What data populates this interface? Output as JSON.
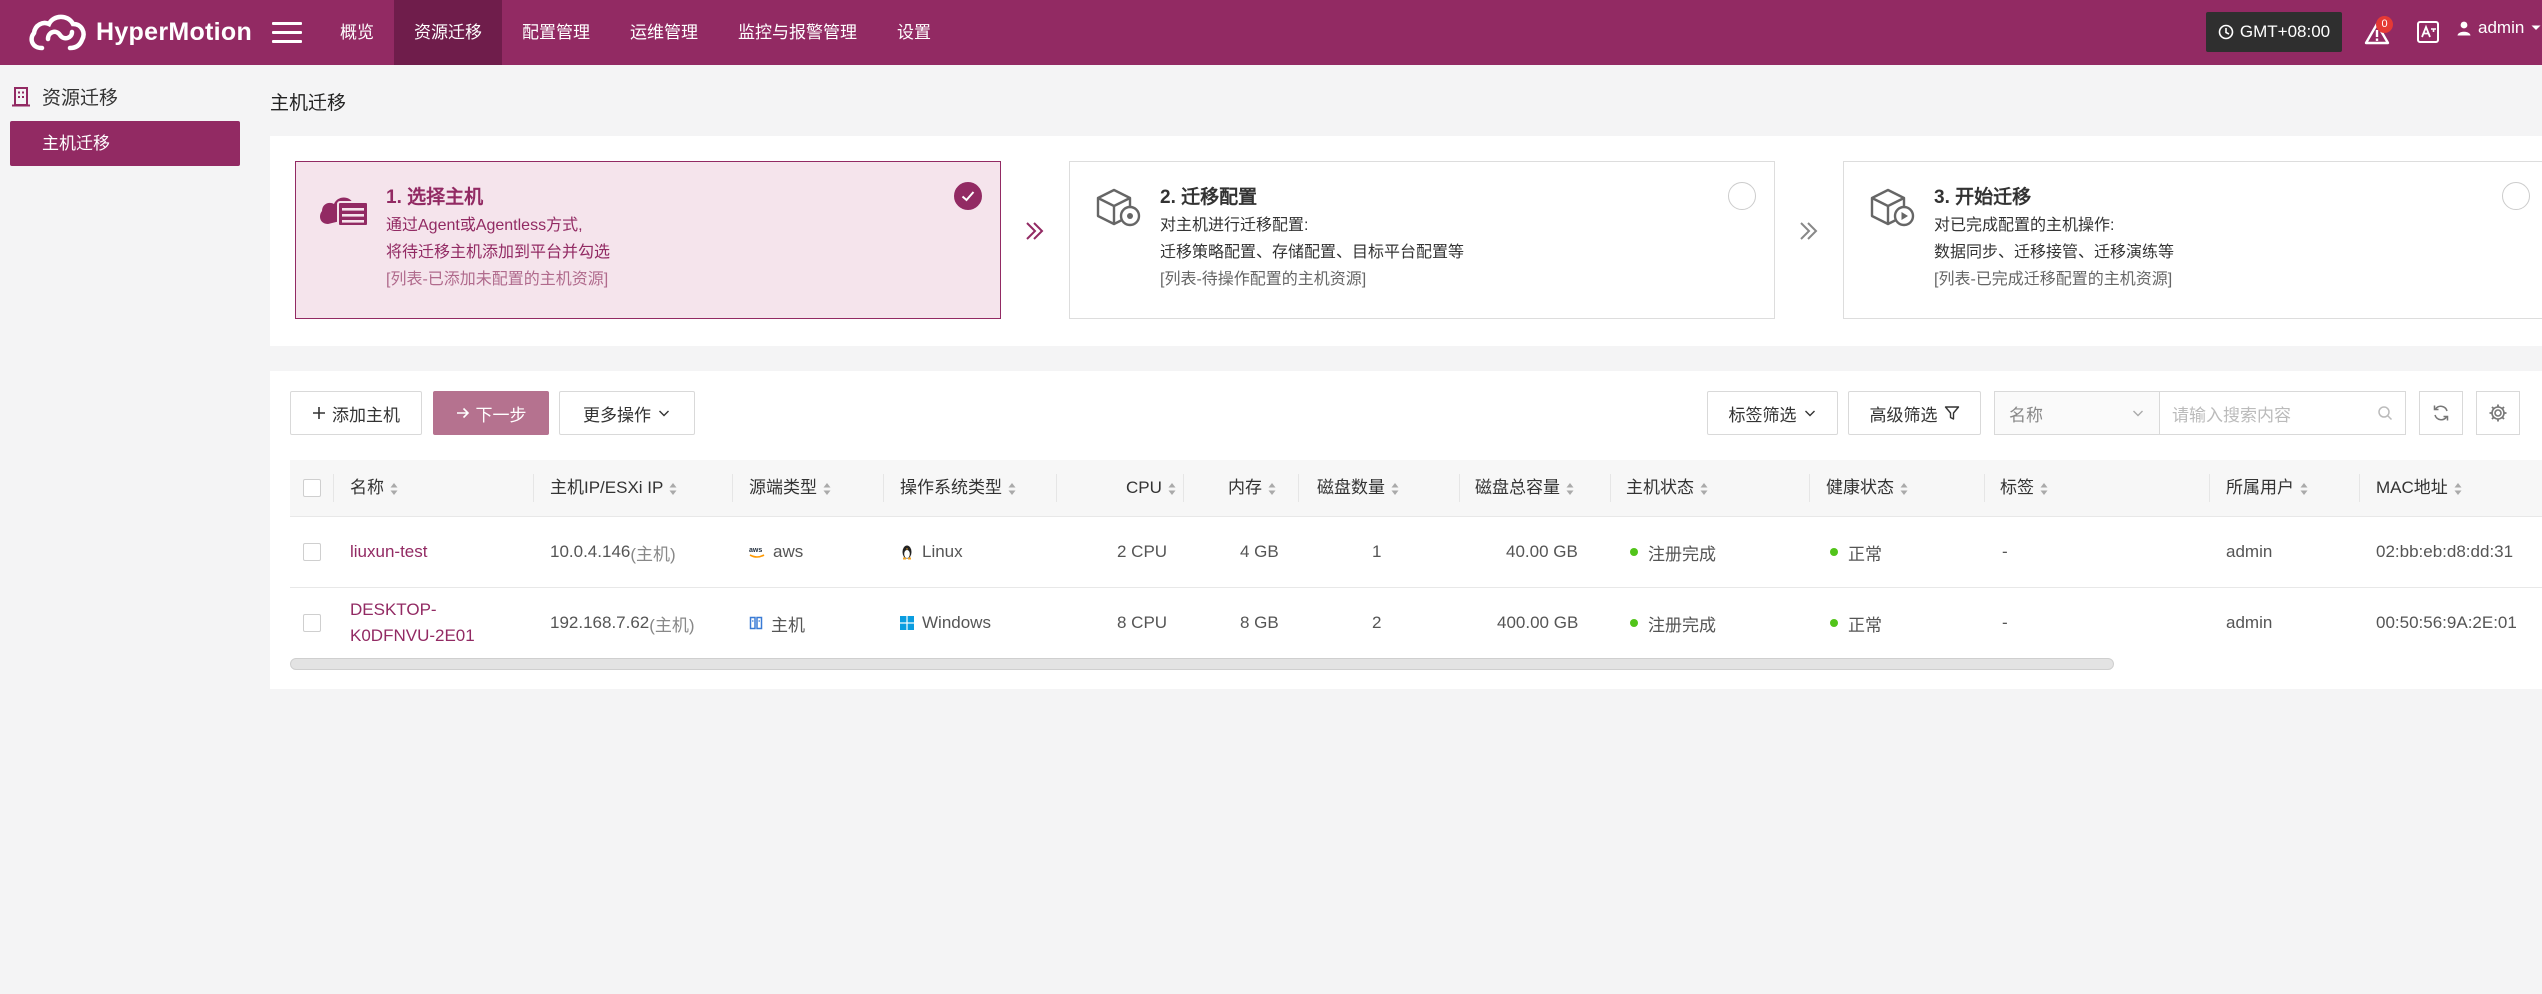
{
  "app": {
    "name": "HyperMotion",
    "logo_icon": "cloud-logo"
  },
  "nav": {
    "items": [
      {
        "label": "概览",
        "active": false
      },
      {
        "label": "资源迁移",
        "active": true
      },
      {
        "label": "配置管理",
        "active": false
      },
      {
        "label": "运维管理",
        "active": false
      },
      {
        "label": "监控与报警管理",
        "active": false
      },
      {
        "label": "设置",
        "active": false
      }
    ],
    "timezone": "GMT+08:00",
    "alert_count": "0",
    "user": "admin"
  },
  "sidebar": {
    "section_title": "资源迁移",
    "items": [
      {
        "label": "主机迁移",
        "active": true
      }
    ]
  },
  "page": {
    "title": "主机迁移"
  },
  "steps": [
    {
      "title": "1. 选择主机",
      "line1": "通过Agent或Agentless方式,",
      "line2": "将待迁移主机添加到平台并勾选",
      "line3": "[列表-已添加未配置的主机资源]",
      "checked": true
    },
    {
      "title": "2. 迁移配置",
      "line1": "对主机进行迁移配置:",
      "line2": "迁移策略配置、存储配置、目标平台配置等",
      "line3": "[列表-待操作配置的主机资源]",
      "checked": false
    },
    {
      "title": "3. 开始迁移",
      "line1": "对已完成配置的主机操作:",
      "line2": "数据同步、迁移接管、迁移演练等",
      "line3": "[列表-已完成迁移配置的主机资源]",
      "checked": false
    }
  ],
  "toolbar": {
    "add_host": "添加主机",
    "next_step": "下一步",
    "more_actions": "更多操作",
    "tag_filter": "标签筛选",
    "advanced_filter": "高级筛选",
    "search_field": "名称",
    "search_placeholder": "请输入搜索内容"
  },
  "table": {
    "columns": [
      "名称",
      "主机IP/ESXi IP",
      "源端类型",
      "操作系统类型",
      "CPU",
      "内存",
      "磁盘数量",
      "磁盘总容量",
      "主机状态",
      "健康状态",
      "标签",
      "所属用户",
      "MAC地址"
    ],
    "rows": [
      {
        "name_line1": "liuxun-test",
        "name_line2": "",
        "ip": "10.0.4.146",
        "ip_suffix": "(主机)",
        "source_type": "aws",
        "source_icon": "aws-icon",
        "os": "Linux",
        "os_icon": "linux-tux-icon",
        "cpu": "2 CPU",
        "memory": "4 GB",
        "disk_count": "1",
        "disk_total": "40.00 GB",
        "host_status": "注册完成",
        "health": "正常",
        "tag": "-",
        "owner": "admin",
        "mac": "02:bb:eb:d8:dd:31"
      },
      {
        "name_line1": "DESKTOP-",
        "name_line2": "K0DFNVU-2E01",
        "ip": "192.168.7.62",
        "ip_suffix": "(主机)",
        "source_type": "主机",
        "source_icon": "server-icon",
        "os": "Windows",
        "os_icon": "windows-icon",
        "cpu": "8 CPU",
        "memory": "8 GB",
        "disk_count": "2",
        "disk_total": "400.00 GB",
        "host_status": "注册完成",
        "health": "正常",
        "tag": "-",
        "owner": "admin",
        "mac": "00:50:56:9A:2E:01"
      }
    ]
  },
  "colors": {
    "brand": "#922a63",
    "brand_dark": "#6f1d4b",
    "status_ok": "#52c41a"
  }
}
